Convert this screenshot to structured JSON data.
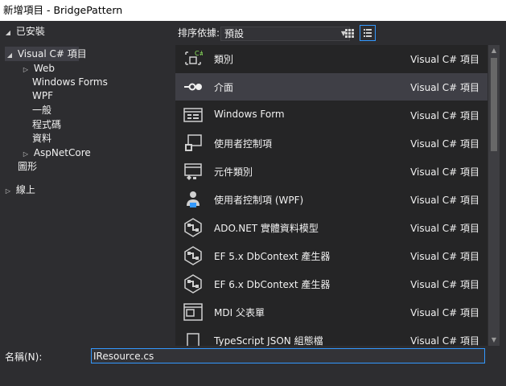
{
  "window": {
    "title": "新增項目 - BridgePattern"
  },
  "tree": {
    "installed": "已安裝",
    "visual_csharp": "Visual C# 項目",
    "web": "Web",
    "windows_forms": "Windows Forms",
    "wpf": "WPF",
    "general": "一般",
    "code": "程式碼",
    "data": "資料",
    "aspnetcore": "AspNetCore",
    "graphics": "圖形",
    "online": "線上"
  },
  "toolbar": {
    "sort_label": "排序依據:",
    "sort_value": "預設"
  },
  "templates": [
    {
      "name": "類別",
      "lang": "Visual C# 項目",
      "icon": "class-icon"
    },
    {
      "name": "介面",
      "lang": "Visual C# 項目",
      "icon": "interface-icon"
    },
    {
      "name": "Windows Form",
      "lang": "Visual C# 項目",
      "icon": "windows-form-icon"
    },
    {
      "name": "使用者控制項",
      "lang": "Visual C# 項目",
      "icon": "user-control-icon"
    },
    {
      "name": "元件類別",
      "lang": "Visual C# 項目",
      "icon": "component-class-icon"
    },
    {
      "name": "使用者控制項 (WPF)",
      "lang": "Visual C# 項目",
      "icon": "wpf-user-control-icon"
    },
    {
      "name": "ADO.NET 實體資料模型",
      "lang": "Visual C# 項目",
      "icon": "data-model-icon"
    },
    {
      "name": "EF 5.x DbContext 產生器",
      "lang": "Visual C# 項目",
      "icon": "ef-generator-icon"
    },
    {
      "name": "EF 6.x DbContext 產生器",
      "lang": "Visual C# 項目",
      "icon": "ef-generator-icon"
    },
    {
      "name": "MDI 父表單",
      "lang": "Visual C# 項目",
      "icon": "mdi-form-icon"
    },
    {
      "name": "TypeScript JSON 組態檔",
      "lang": "Visual C# 項目",
      "icon": "json-config-icon"
    }
  ],
  "selected_template": "介面",
  "bottom": {
    "name_label": "名稱(N):",
    "name_value": "IResource.cs"
  },
  "colors": {
    "background": "#2d2d30",
    "list_background": "#252526",
    "selection": "#3f3f46",
    "accent": "#3399ff",
    "csharp_green": "#8ce35c"
  }
}
